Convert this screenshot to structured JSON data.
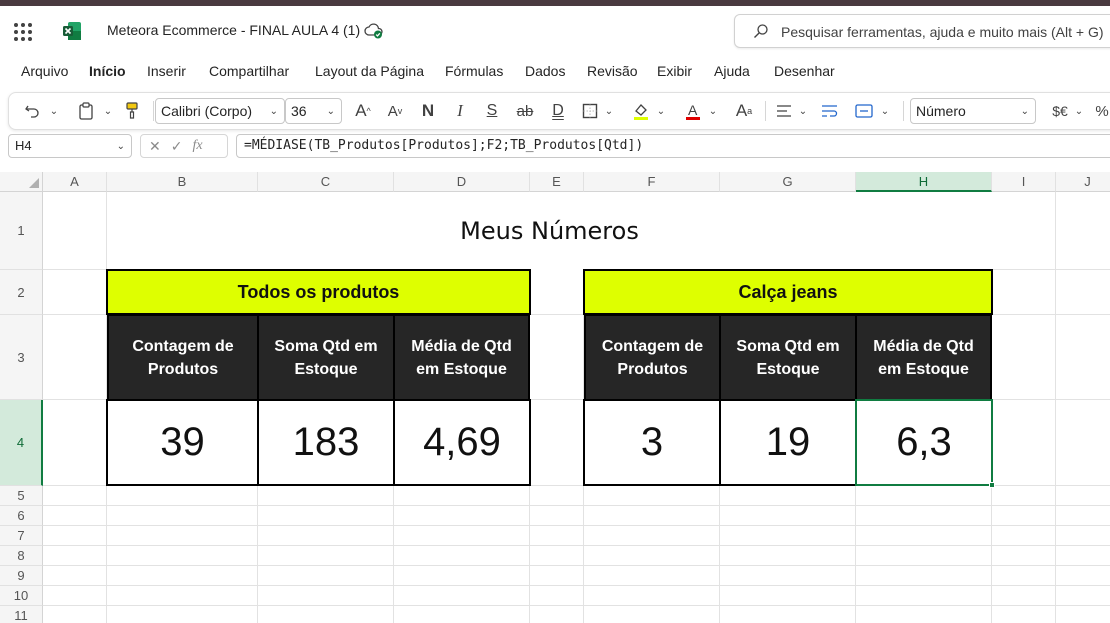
{
  "app": {
    "document_title": "Meteora Ecommerce - FINAL AULA 4 (1)",
    "search_placeholder": "Pesquisar ferramentas, ajuda e muito mais (Alt + G)"
  },
  "menu": {
    "items": [
      "Arquivo",
      "Início",
      "Inserir",
      "Compartilhar",
      "Layout da Página",
      "Fórmulas",
      "Dados",
      "Revisão",
      "Exibir",
      "Ajuda",
      "Desenhar"
    ],
    "active": "Início"
  },
  "ribbon": {
    "font_name": "Calibri (Corpo)",
    "font_size": "36",
    "number_format": "Número",
    "bold_label": "N",
    "italic_label": "I",
    "underline_label": "S",
    "strike_label": "ab",
    "currency_label": "$€"
  },
  "formula_bar": {
    "cell_ref": "H4",
    "formula": "=MÉDIASE(TB_Produtos[Produtos];F2;TB_Produtos[Qtd])",
    "fx_label": "fx"
  },
  "sheet": {
    "columns": [
      "A",
      "B",
      "C",
      "D",
      "E",
      "F",
      "G",
      "H",
      "I",
      "J"
    ],
    "selected_column": "H",
    "rows": [
      "1",
      "2",
      "3",
      "4",
      "5",
      "6",
      "7",
      "8",
      "9",
      "10",
      "11"
    ],
    "selected_row": "4",
    "title": "Meus Números",
    "table_all": {
      "heading": "Todos os produtos",
      "headers": [
        "Contagem de Produtos",
        "Soma Qtd em Estoque",
        "Média de Qtd em Estoque"
      ],
      "values": [
        "39",
        "183",
        "4,69"
      ]
    },
    "table_jeans": {
      "heading": "Calça jeans",
      "headers": [
        "Contagem de Produtos",
        "Soma Qtd em Estoque",
        "Média de Qtd em Estoque"
      ],
      "values": [
        "3",
        "19",
        "6,3"
      ]
    }
  },
  "colors": {
    "accent_green": "#107c41",
    "heading_fill": "#deff00",
    "header_fill": "#262626"
  }
}
